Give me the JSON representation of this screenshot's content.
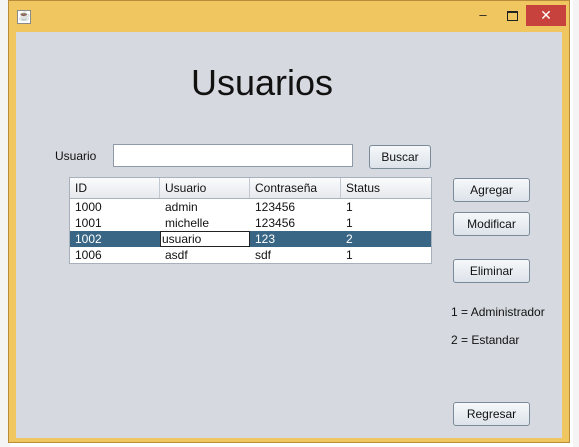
{
  "window": {
    "title": "",
    "controls": {
      "minimize": "–",
      "maximize": "□",
      "close": "✕"
    }
  },
  "heading": "Usuarios",
  "search": {
    "label": "Usuario",
    "value": "",
    "button": "Buscar"
  },
  "table": {
    "columns": [
      "ID",
      "Usuario",
      "Contraseña",
      "Status"
    ],
    "rows": [
      [
        "1000",
        "admin",
        "123456",
        "1"
      ],
      [
        "1001",
        "michelle",
        "123456",
        "1"
      ],
      [
        "1002",
        "usuario",
        "123",
        "2"
      ],
      [
        "1006",
        "asdf",
        "sdf",
        "1"
      ]
    ],
    "selected_row": 2
  },
  "buttons": {
    "agregar": "Agregar",
    "modificar": "Modificar",
    "eliminar": "Eliminar",
    "regresar": "Regresar"
  },
  "legend": {
    "admin": "1 = Administrador",
    "estandar": "2 = Estandar"
  },
  "colors": {
    "title_bar": "#efc660",
    "close_button": "#c7423c",
    "client_bg": "#d6d9df",
    "selection": "#3a6685"
  }
}
